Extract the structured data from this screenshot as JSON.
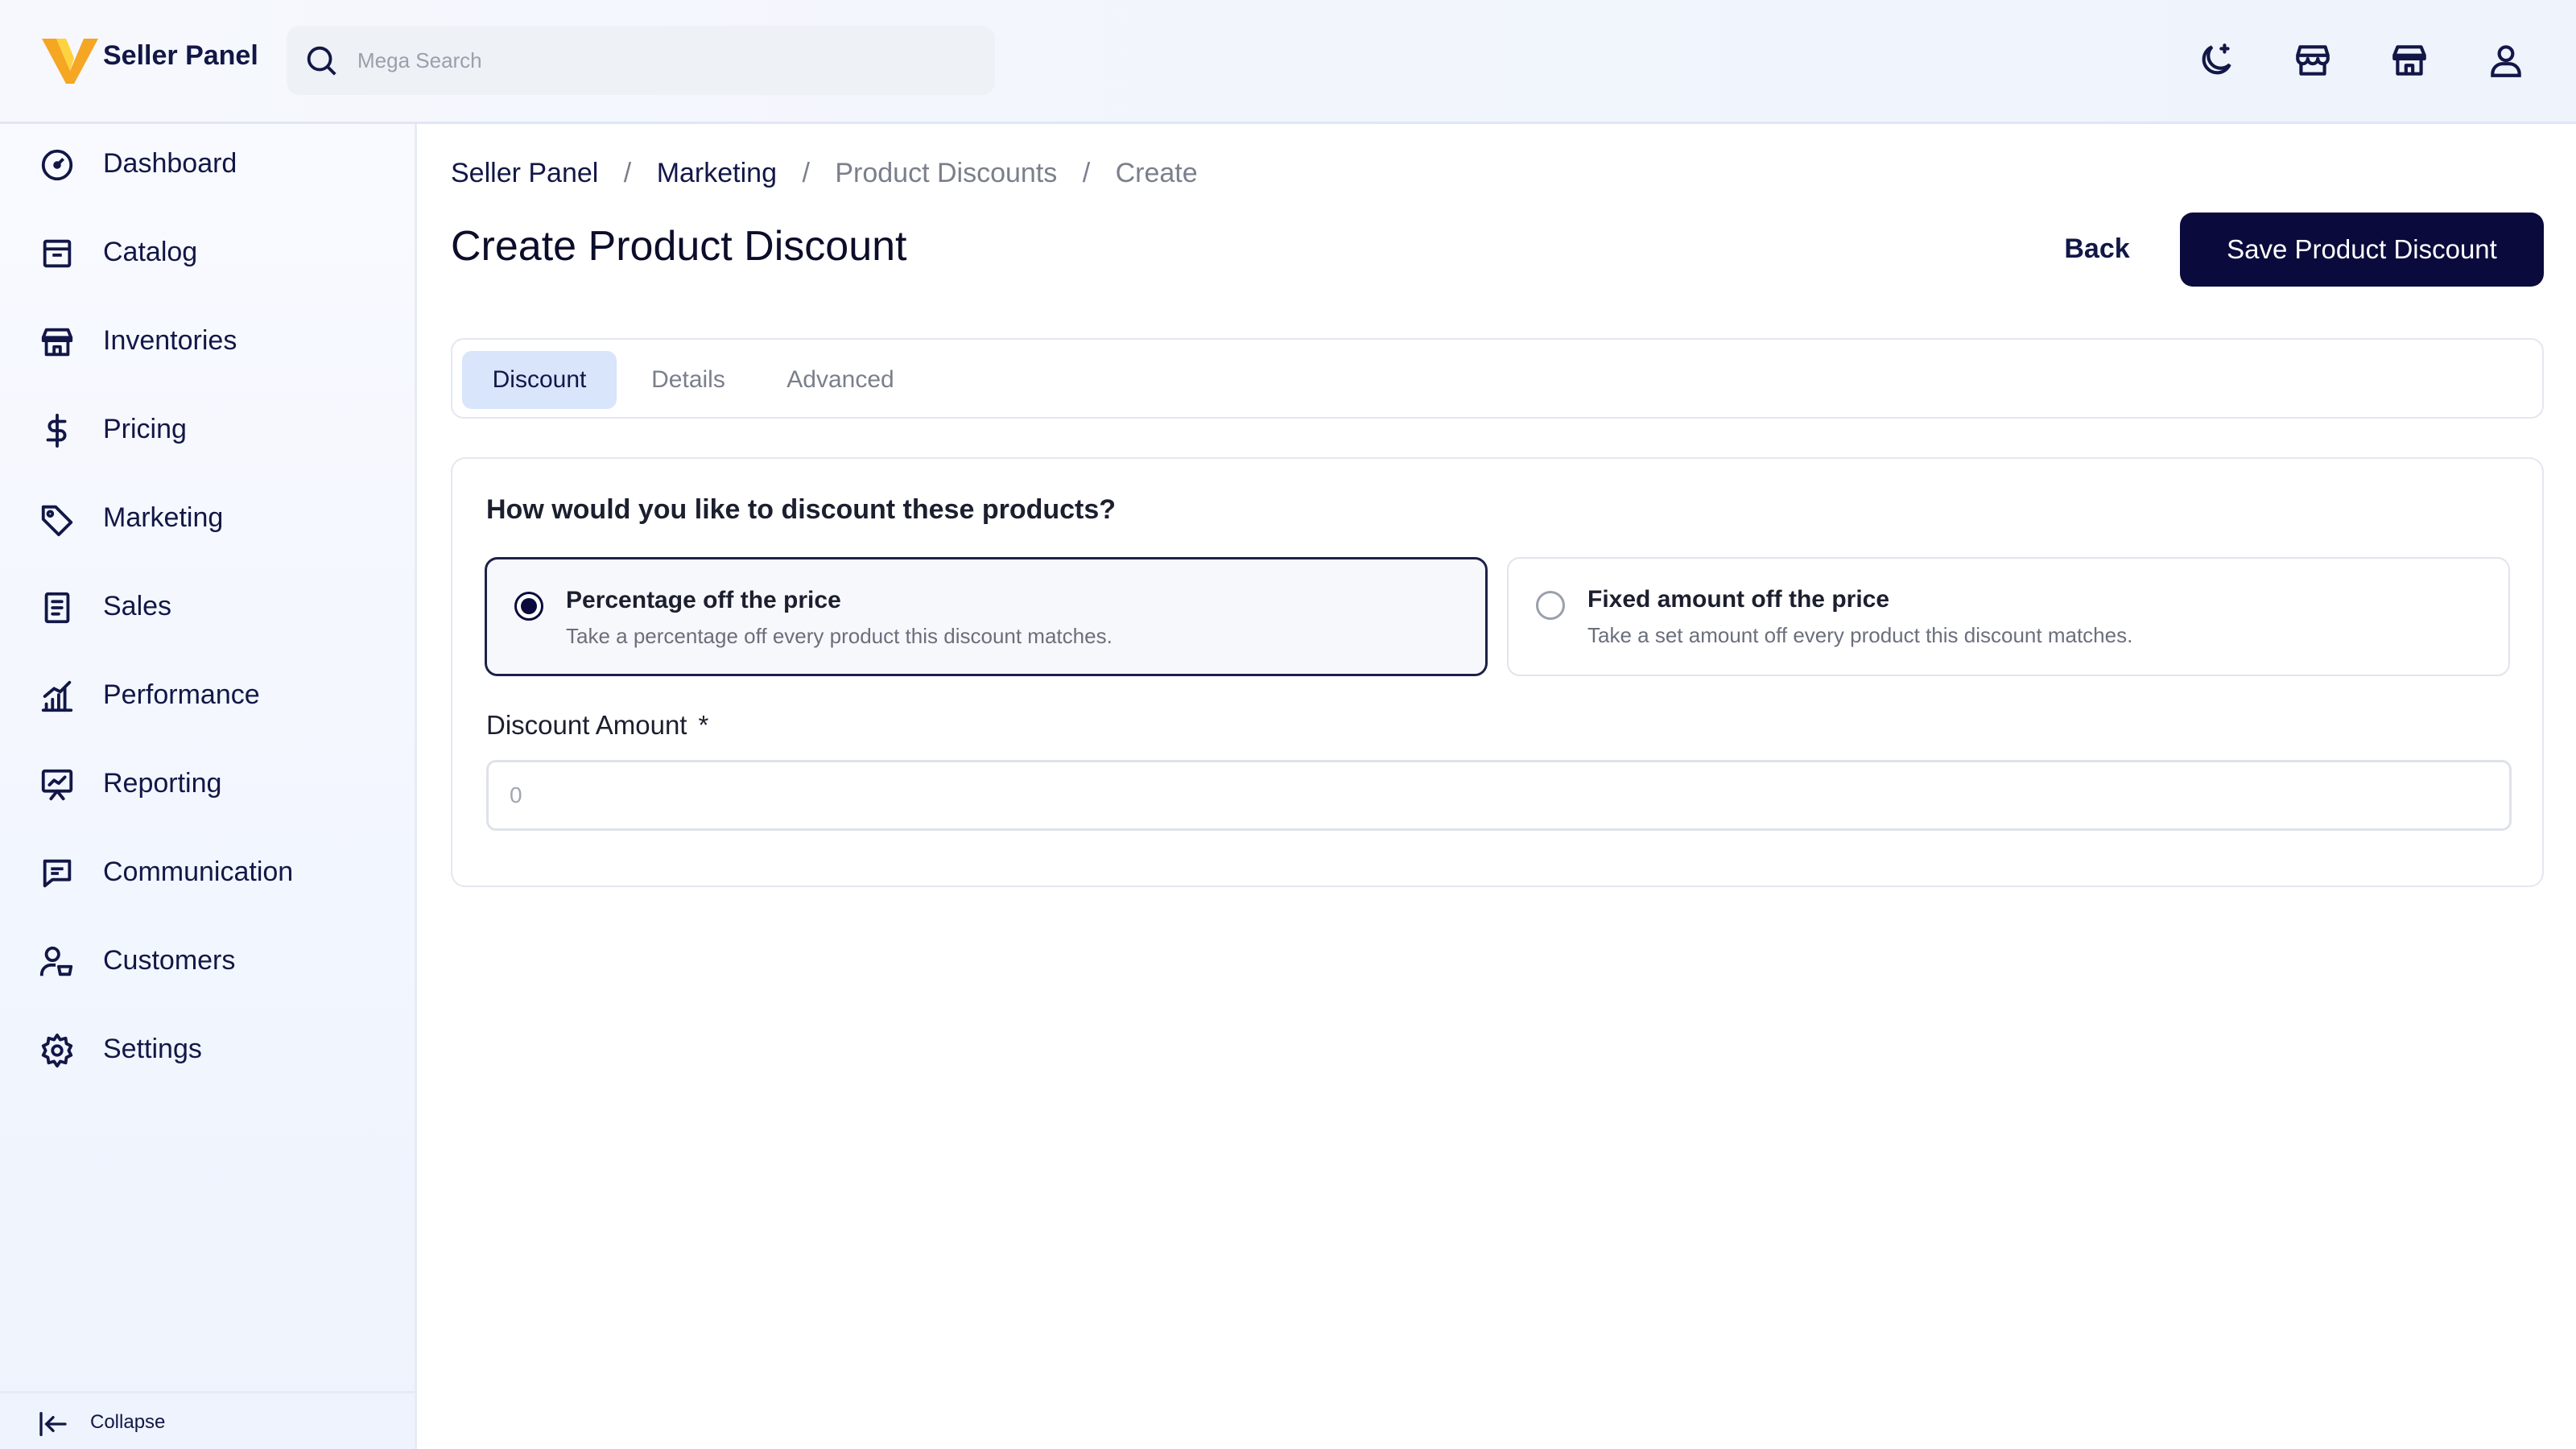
{
  "header": {
    "app_title": "Seller Panel",
    "search_placeholder": "Mega Search",
    "icons": [
      "moon-icon",
      "store-icon",
      "warehouse-icon",
      "user-icon"
    ]
  },
  "sidebar": {
    "items": [
      {
        "label": "Dashboard",
        "icon": "dashboard-icon"
      },
      {
        "label": "Catalog",
        "icon": "catalog-icon"
      },
      {
        "label": "Inventories",
        "icon": "inventories-icon"
      },
      {
        "label": "Pricing",
        "icon": "dollar-icon"
      },
      {
        "label": "Marketing",
        "icon": "tag-icon"
      },
      {
        "label": "Sales",
        "icon": "receipt-icon"
      },
      {
        "label": "Performance",
        "icon": "chart-icon"
      },
      {
        "label": "Reporting",
        "icon": "presentation-icon"
      },
      {
        "label": "Communication",
        "icon": "message-icon"
      },
      {
        "label": "Customers",
        "icon": "customers-icon"
      },
      {
        "label": "Settings",
        "icon": "gear-icon"
      }
    ],
    "collapse_label": "Collapse"
  },
  "breadcrumb": [
    "Seller Panel",
    "Marketing",
    "Product Discounts",
    "Create"
  ],
  "page_title": "Create Product Discount",
  "actions": {
    "back_label": "Back",
    "save_label": "Save Product Discount"
  },
  "tabs": [
    {
      "label": "Discount",
      "active": true
    },
    {
      "label": "Details",
      "active": false
    },
    {
      "label": "Advanced",
      "active": false
    }
  ],
  "form": {
    "question": "How would you like to discount these products?",
    "options": [
      {
        "title": "Percentage off the price",
        "description": "Take a percentage off every product this discount matches.",
        "selected": true
      },
      {
        "title": "Fixed amount off the price",
        "description": "Take a set amount off every product this discount matches.",
        "selected": false
      }
    ],
    "amount_label": "Discount Amount",
    "amount_required_mark": "*",
    "amount_placeholder": "0",
    "amount_value": ""
  },
  "colors": {
    "primary": "#0a0a3c",
    "active_tab_bg": "#d8e5fb",
    "logo_orange": "#f5a623",
    "logo_yellow": "#ffd23f",
    "text_dark": "#121747",
    "text_muted": "#7b7f8c"
  }
}
